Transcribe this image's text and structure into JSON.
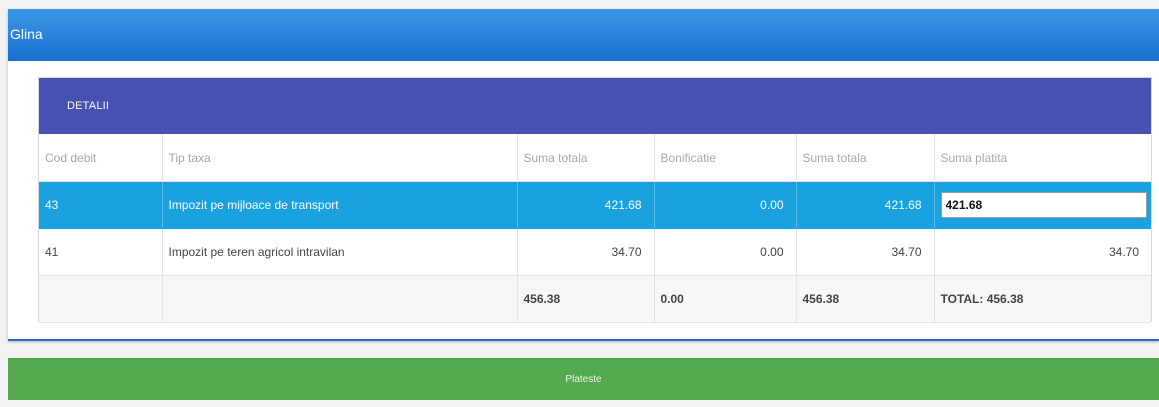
{
  "window": {
    "title": "Glina"
  },
  "panel": {
    "heading": "DETALII"
  },
  "table": {
    "columns": [
      "Cod debit",
      "Tip taxa",
      "Suma totala",
      "Bonificatie",
      "Suma totala",
      "Suma platita"
    ],
    "rows": [
      {
        "cod": "43",
        "tip": "Impozit pe mijloace de transport",
        "suma_totala": "421.68",
        "bonificatie": "0.00",
        "suma_totala2": "421.68",
        "suma_platita": "421.68",
        "selected": true
      },
      {
        "cod": "41",
        "tip": "Impozit pe teren agricol intravilan",
        "suma_totala": "34.70",
        "bonificatie": "0.00",
        "suma_totala2": "34.70",
        "suma_platita": "34.70",
        "selected": false
      }
    ],
    "totals": {
      "suma_totala": "456.38",
      "bonificatie": "0.00",
      "suma_totala2": "456.38",
      "suma_platita": "TOTAL: 456.38"
    }
  },
  "actions": {
    "pay_label": "Plateste"
  },
  "colors": {
    "titlebar": "#1a6fd0",
    "panel_head": "#4651b2",
    "selected_row": "#19a2df",
    "pay_button": "#55a94e"
  }
}
